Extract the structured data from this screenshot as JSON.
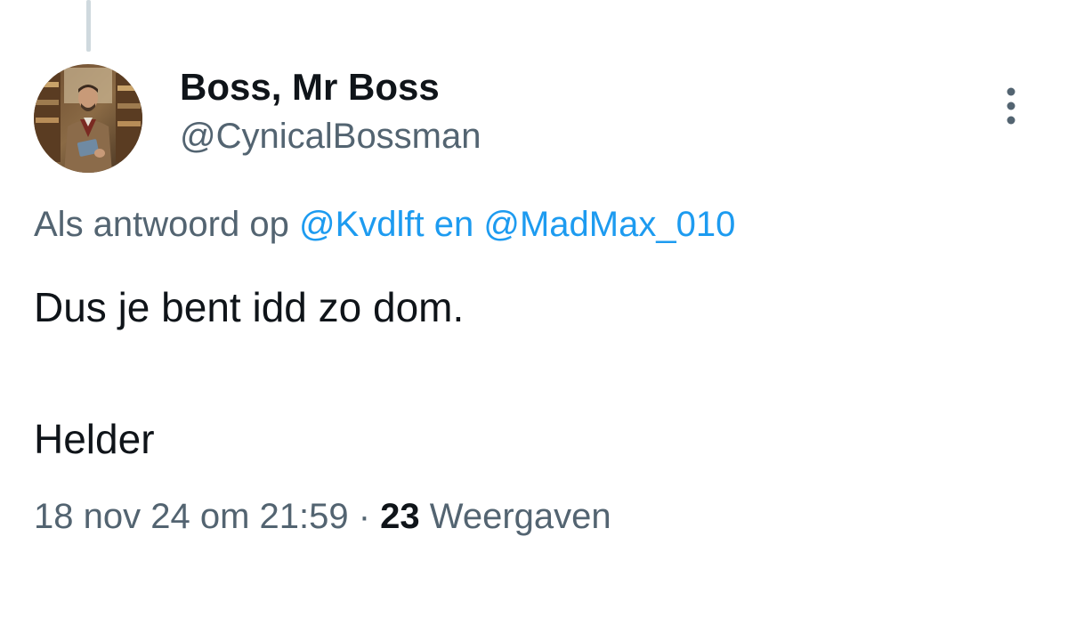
{
  "tweet": {
    "author": {
      "display_name": "Boss, Mr Boss",
      "handle": "@CynicalBossman",
      "avatar_icon": "avatar-photo"
    },
    "reply_context": {
      "prefix": "Als antwoord op",
      "mention_1": "@Kvdlft",
      "conjunction": "en",
      "mention_2": "@MadMax_010"
    },
    "text_lines": [
      "Dus je bent idd zo dom.",
      "Helder"
    ],
    "timestamp": "18 nov 24 om 21:59",
    "separator": "·",
    "views_count": "23",
    "views_label": "Weergaven",
    "more_icon": "more-vertical-icon"
  },
  "colors": {
    "text_primary": "#0f1419",
    "text_secondary": "#536471",
    "link": "#1d9bf0",
    "thread_line": "#cfd9de"
  }
}
